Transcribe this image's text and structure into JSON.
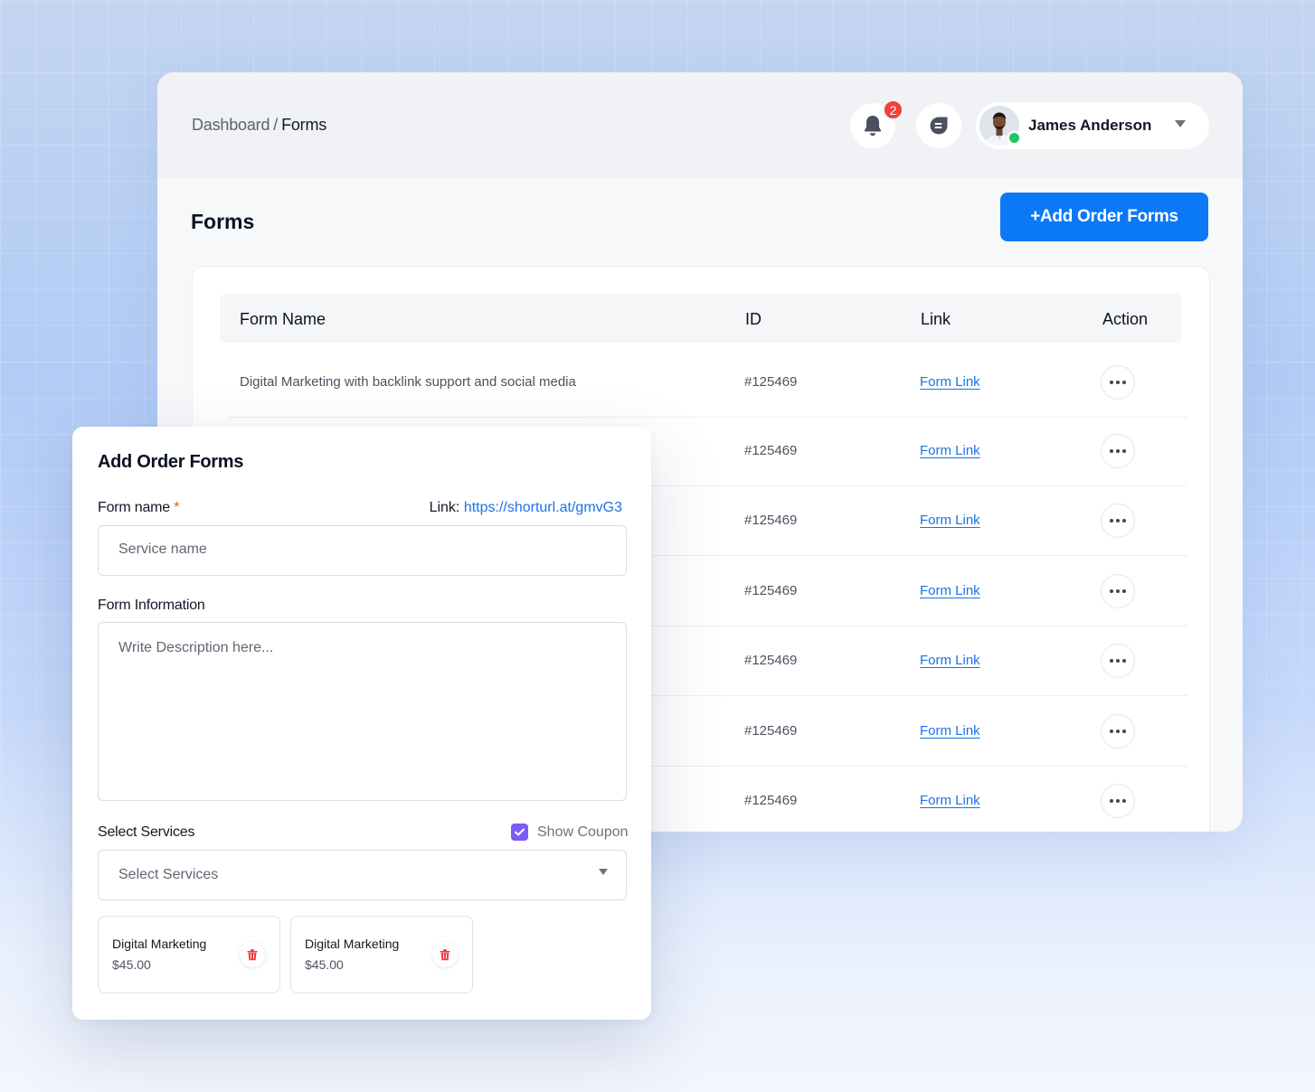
{
  "breadcrumb": {
    "parent": "Dashboard",
    "separator": "/",
    "current": "Forms"
  },
  "header": {
    "notification_count": "2",
    "user_name": "James Anderson",
    "icons": {
      "notifications": "bell-icon",
      "messages": "chat-icon",
      "menu": "caret-down-icon"
    }
  },
  "page": {
    "title": "Forms",
    "add_button": "+Add Order Forms"
  },
  "table": {
    "columns": {
      "name": "Form Name",
      "id": "ID",
      "link": "Link",
      "action": "Action"
    },
    "rows": [
      {
        "name": "Digital Marketing with backlink support and social media",
        "id": "#125469",
        "link": "Form Link"
      },
      {
        "name": "",
        "id": "#125469",
        "link": "Form Link"
      },
      {
        "name": "",
        "id": "#125469",
        "link": "Form Link"
      },
      {
        "name": "",
        "id": "#125469",
        "link": "Form Link"
      },
      {
        "name": "",
        "id": "#125469",
        "link": "Form Link"
      },
      {
        "name": "",
        "id": "#125469",
        "link": "Form Link"
      },
      {
        "name": "",
        "id": "#125469",
        "link": "Form Link"
      }
    ]
  },
  "modal": {
    "title": "Add Order Forms",
    "form_name_label": "Form name",
    "required_mark": "*",
    "link_label": "Link:",
    "link_url": "https://shorturl.at/gmvG3",
    "form_name_placeholder": "Service name",
    "form_info_label": "Form Information",
    "form_info_placeholder": "Write Description here...",
    "select_services_label": "Select Services",
    "show_coupon_label": "Show Coupon",
    "show_coupon_checked": true,
    "select_placeholder": "Select Services",
    "selected_services": [
      {
        "name": "Digital Marketing",
        "price": "$45.00"
      },
      {
        "name": "Digital Marketing",
        "price": "$45.00"
      }
    ]
  },
  "colors": {
    "primary": "#0b78f5",
    "link": "#1a73e8",
    "badge": "#f43f3f",
    "checkbox": "#7b5cf5",
    "delete": "#ef3b3b",
    "online": "#22c55e"
  }
}
